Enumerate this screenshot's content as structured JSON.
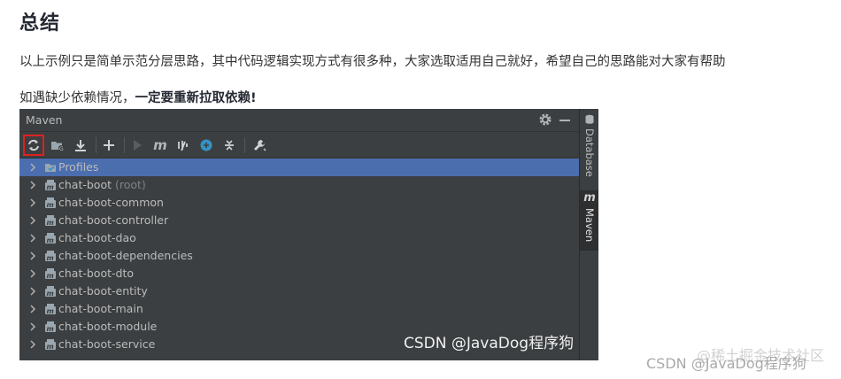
{
  "article": {
    "heading": "总结",
    "para1": "以上示例只是简单示范分层思路，其中代码逻辑实现方式有很多种，大家选取适用自己就好，希望自己的思路能对大家有帮助",
    "para2_prefix": "如遇缺少依赖情况，",
    "para2_bold": "一定要重新拉取依赖!"
  },
  "ide": {
    "panel_title": "Maven",
    "toolbar": [
      {
        "name": "reload-all-maven-projects-icon",
        "selected": true
      },
      {
        "name": "generate-sources-icon"
      },
      {
        "name": "download-sources-icon"
      },
      {
        "name": "add-maven-project-icon"
      },
      {
        "name": "run-maven-build-icon"
      },
      {
        "name": "execute-maven-goal-icon"
      },
      {
        "name": "toggle-offline-mode-icon"
      },
      {
        "name": "skip-tests-icon"
      },
      {
        "name": "show-dependencies-icon"
      },
      {
        "name": "maven-settings-icon"
      }
    ],
    "tree": [
      {
        "label": "Profiles",
        "sub": "",
        "selected": true,
        "icon": "profiles-folder-icon"
      },
      {
        "label": "chat-boot",
        "sub": "(root)",
        "icon": "maven-module-icon"
      },
      {
        "label": "chat-boot-common",
        "sub": "",
        "icon": "maven-module-icon"
      },
      {
        "label": "chat-boot-controller",
        "sub": "",
        "icon": "maven-module-icon"
      },
      {
        "label": "chat-boot-dao",
        "sub": "",
        "icon": "maven-module-icon"
      },
      {
        "label": "chat-boot-dependencies",
        "sub": "",
        "icon": "maven-module-icon"
      },
      {
        "label": "chat-boot-dto",
        "sub": "",
        "icon": "maven-module-icon"
      },
      {
        "label": "chat-boot-entity",
        "sub": "",
        "icon": "maven-module-icon"
      },
      {
        "label": "chat-boot-main",
        "sub": "",
        "icon": "maven-module-icon"
      },
      {
        "label": "chat-boot-module",
        "sub": "",
        "icon": "maven-module-icon"
      },
      {
        "label": "chat-boot-service",
        "sub": "",
        "icon": "maven-module-icon"
      }
    ],
    "side_tabs": {
      "database": "Database",
      "maven": "Maven"
    },
    "colors": {
      "selection": "#4b6eaf",
      "highlight_box": "#e02020",
      "panel_bg": "#3c3f41"
    }
  },
  "watermarks": {
    "inner": "CSDN @JavaDog程序狗",
    "outer": "CSDN @JavaDog程序狗",
    "outer2": "@稀土掘金技术社区"
  }
}
